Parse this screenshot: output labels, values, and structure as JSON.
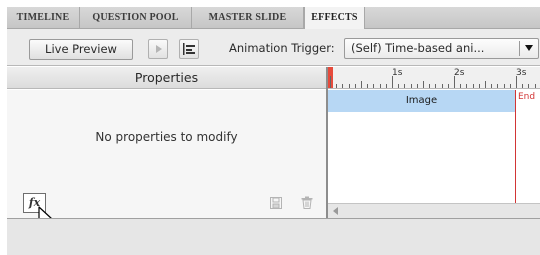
{
  "tabs": [
    {
      "label": "TIMELINE"
    },
    {
      "label": "QUESTION POOL"
    },
    {
      "label": "MASTER SLIDE"
    },
    {
      "label": "EFFECTS"
    }
  ],
  "toolbar": {
    "live_preview_label": "Live Preview",
    "play_icon": "play-icon",
    "timeline_icon": "timeline-toggle-icon",
    "animation_trigger_label": "Animation Trigger:",
    "animation_trigger_value": "(Self) Time-based ani..."
  },
  "properties": {
    "header": "Properties",
    "empty_message": "No properties to modify",
    "fx_label": "fx"
  },
  "timeline": {
    "ruler_labels": [
      "1s",
      "2s",
      "3s"
    ],
    "image_bar_label": "Image",
    "end_label": "End"
  },
  "colors": {
    "playhead": "#e64b3c",
    "image_bar": "#b7d7f4",
    "end_marker": "#d23535"
  }
}
